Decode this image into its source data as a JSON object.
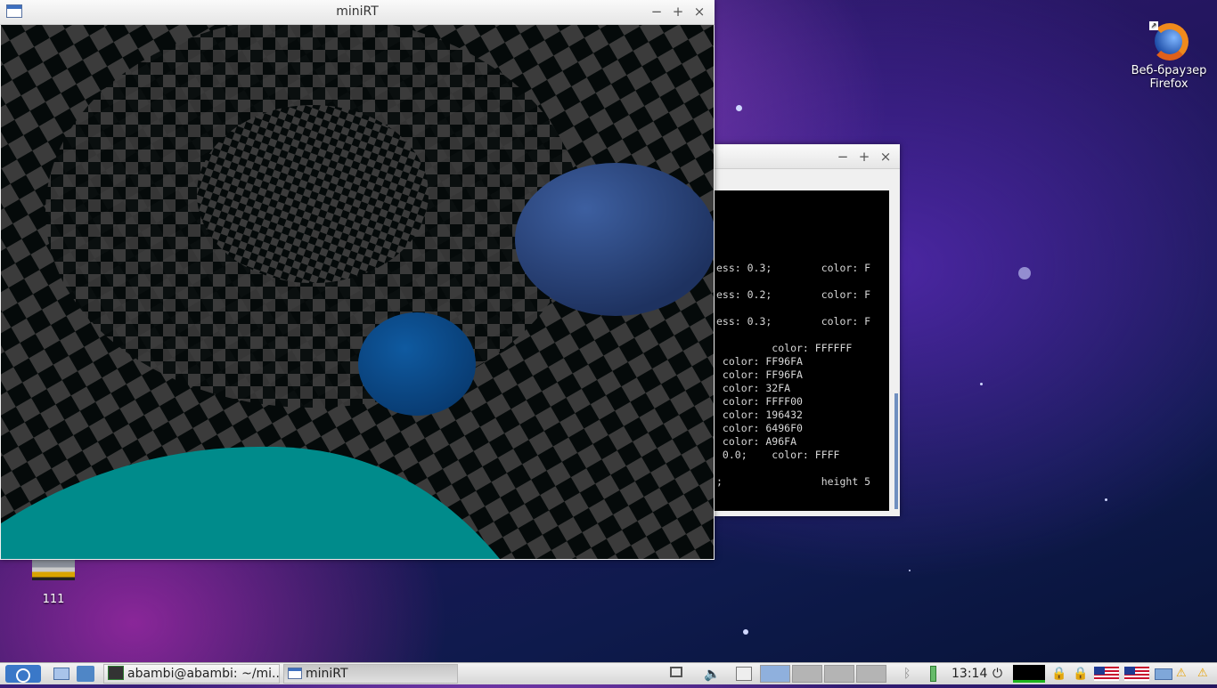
{
  "desktop": {
    "icons": [
      {
        "label": "Веб-браузер Firefox",
        "line1": "Веб-браузер",
        "line2": "Firefox"
      },
      {
        "label": "111"
      }
    ]
  },
  "minirt_window": {
    "title": "miniRT",
    "buttons": {
      "minimize": "−",
      "maximize": "+",
      "close": "×"
    }
  },
  "terminal_window": {
    "buttons": {
      "minimize": "−",
      "maximize": "+",
      "close": "×"
    },
    "lines": [
      "ess: 0.3;        color: F",
      "ess: 0.2;        color: F",
      "ess: 0.3;        color: F",
      "         color: FFFFFF",
      " color: FF96FA",
      " color: FF96FA",
      " color: 32FA",
      " color: FFFF00",
      " color: 196432",
      " color: 6496F0",
      " color: A96FA",
      " 0.0;    color: FFFF",
      "",
      ";                height 5"
    ]
  },
  "taskbar": {
    "tasks": [
      {
        "label": "abambi@abambi: ~/mi..."
      },
      {
        "label": "miniRT"
      }
    ],
    "clock": "13:14",
    "volume_icon": "speaker-icon",
    "power_icon": "power-icon"
  },
  "scene": {
    "floor_colors": [
      "#3b3b3b",
      "#050a0a"
    ],
    "spheres": [
      {
        "color": "#2f4c86",
        "name": "large-blue-sphere"
      },
      {
        "color": "#0d4a8a",
        "name": "small-blue-sphere"
      },
      {
        "color": "#008b8b",
        "name": "teal-sphere"
      }
    ]
  }
}
